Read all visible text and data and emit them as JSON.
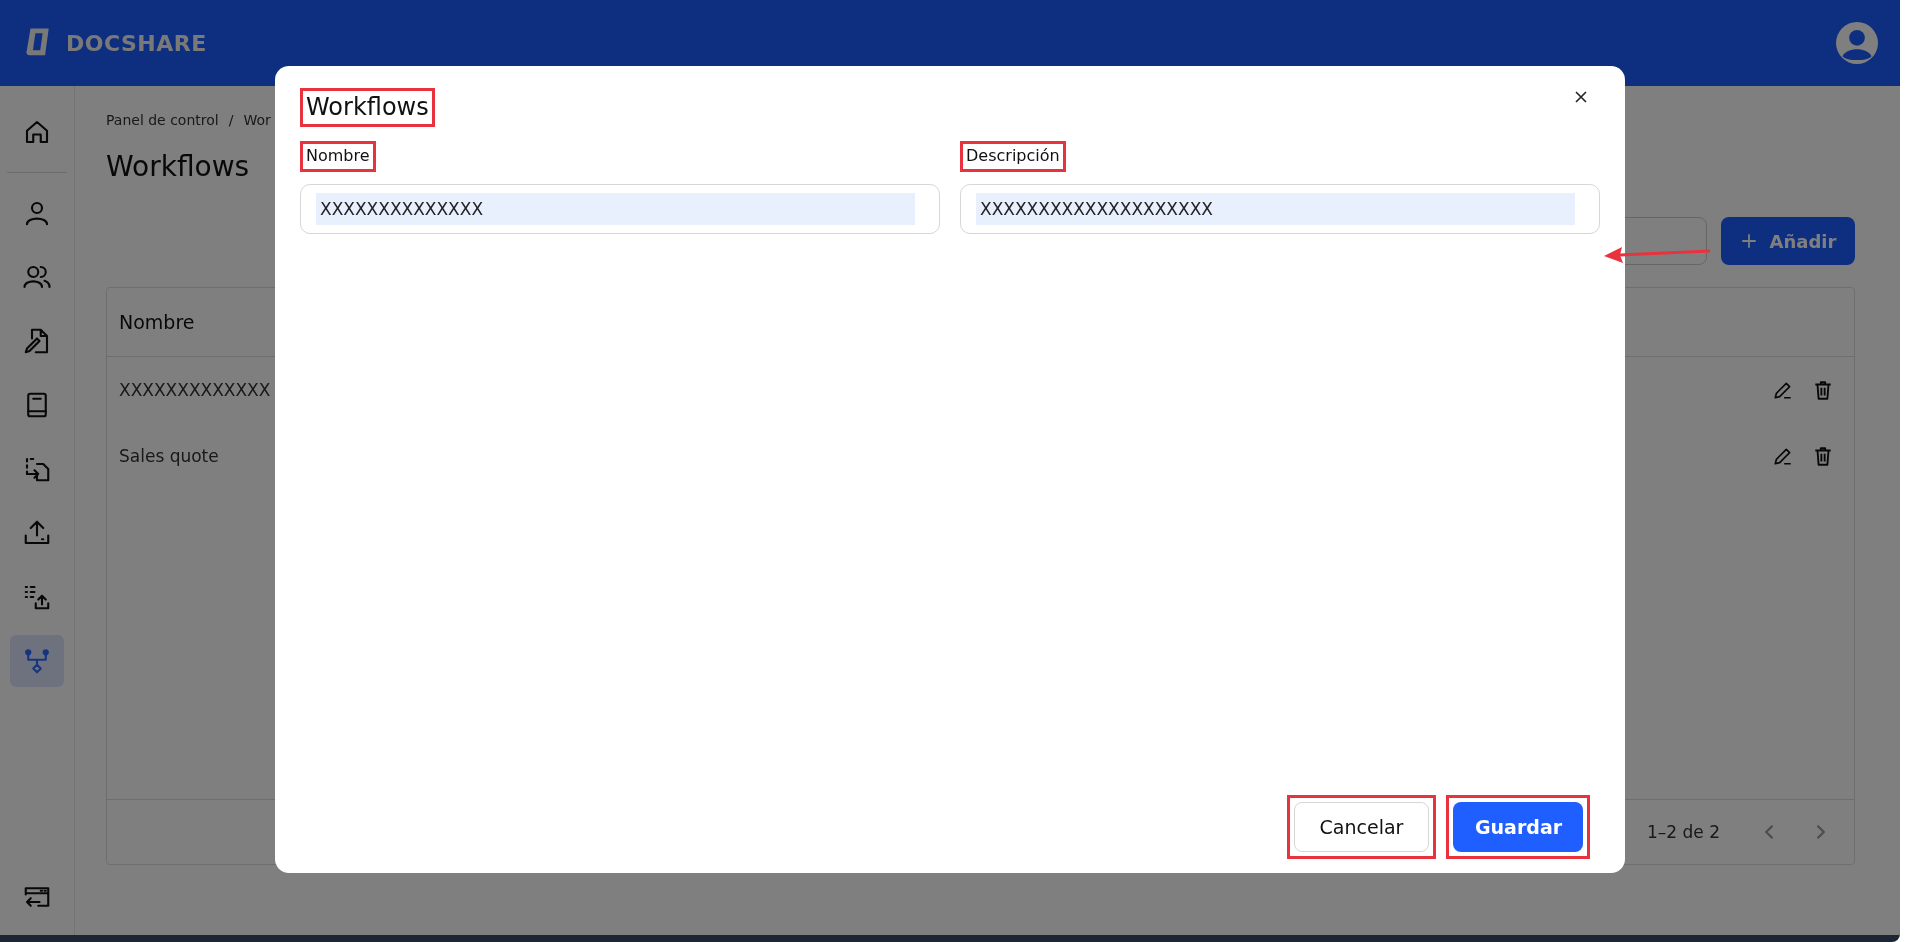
{
  "header": {
    "brand": "DOCSHARE"
  },
  "sidebar": {
    "items": [
      {
        "selected": false
      },
      {
        "selected": false
      },
      {
        "selected": false
      },
      {
        "selected": false
      },
      {
        "selected": false
      },
      {
        "selected": false
      },
      {
        "selected": false
      },
      {
        "selected": false
      },
      {
        "selected": true
      }
    ]
  },
  "breadcrumb": {
    "items": [
      "Panel de control",
      "Wor"
    ],
    "separator": "/"
  },
  "page_title": "Workflows",
  "add_button": {
    "label": "Añadir"
  },
  "table": {
    "columns": [
      "Nombre"
    ],
    "rows": [
      {
        "name": "XXXXXXXXXXXXX"
      },
      {
        "name": "Sales quote"
      }
    ],
    "pagination": {
      "range": "1–2 de 2"
    }
  },
  "dialog": {
    "title": {
      "text": "Workflows",
      "highlighted": true
    },
    "fields": [
      {
        "label": "Nombre",
        "highlighted": true,
        "value": "XXXXXXXXXXXXXX"
      },
      {
        "label": "Descripción",
        "highlighted": true,
        "value": "XXXXXXXXXXXXXXXXXXXX"
      }
    ],
    "buttons": [
      {
        "label": "Cancelar",
        "kind": "secondary",
        "highlighted": true
      },
      {
        "label": "Guardar",
        "kind": "primary",
        "highlighted": true
      }
    ],
    "annotation_arrow": true
  }
}
